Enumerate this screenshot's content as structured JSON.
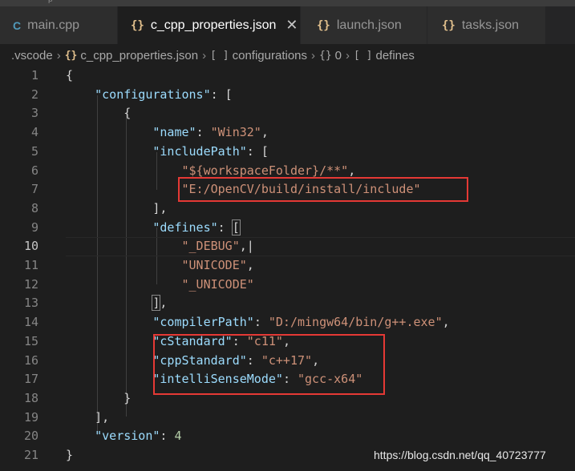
{
  "window": {
    "title_fragment": "p"
  },
  "tabs": [
    {
      "label": "main.cpp",
      "icon": "C"
    },
    {
      "label": "c_cpp_properties.json",
      "icon": "{}",
      "close": "✕"
    },
    {
      "label": "launch.json",
      "icon": "{}"
    },
    {
      "label": "tasks.json",
      "icon": "{}"
    }
  ],
  "breadcrumb": [
    {
      "label": ".vscode",
      "sym": ""
    },
    {
      "label": "c_cpp_properties.json",
      "sym": "{}"
    },
    {
      "label": "configurations",
      "sym": "[ ]"
    },
    {
      "label": "0",
      "sym": "{}"
    },
    {
      "label": "defines",
      "sym": "[ ]"
    }
  ],
  "editor": {
    "current_line": 10,
    "lines": [
      {
        "num": "1",
        "tokens": [
          {
            "t": "{",
            "c": "p"
          }
        ]
      },
      {
        "num": "2",
        "tokens": [
          {
            "t": "    ",
            "c": "p"
          },
          {
            "t": "\"configurations\"",
            "c": "k"
          },
          {
            "t": ": [",
            "c": "p"
          }
        ]
      },
      {
        "num": "3",
        "tokens": [
          {
            "t": "        {",
            "c": "p"
          }
        ]
      },
      {
        "num": "4",
        "tokens": [
          {
            "t": "            ",
            "c": "p"
          },
          {
            "t": "\"name\"",
            "c": "k"
          },
          {
            "t": ": ",
            "c": "p"
          },
          {
            "t": "\"Win32\"",
            "c": "s"
          },
          {
            "t": ",",
            "c": "p"
          }
        ]
      },
      {
        "num": "5",
        "tokens": [
          {
            "t": "            ",
            "c": "p"
          },
          {
            "t": "\"includePath\"",
            "c": "k"
          },
          {
            "t": ": [",
            "c": "p"
          }
        ]
      },
      {
        "num": "6",
        "tokens": [
          {
            "t": "                ",
            "c": "p"
          },
          {
            "t": "\"${workspaceFolder}/**\"",
            "c": "s"
          },
          {
            "t": ",",
            "c": "p"
          }
        ]
      },
      {
        "num": "7",
        "tokens": [
          {
            "t": "                ",
            "c": "p"
          },
          {
            "t": "\"E:/OpenCV/build/install/include\"",
            "c": "s"
          }
        ]
      },
      {
        "num": "8",
        "tokens": [
          {
            "t": "            ],",
            "c": "p"
          }
        ]
      },
      {
        "num": "9",
        "tokens": [
          {
            "t": "            ",
            "c": "p"
          },
          {
            "t": "\"defines\"",
            "c": "k"
          },
          {
            "t": ": ",
            "c": "p"
          },
          {
            "t": "[",
            "c": "p bm"
          }
        ]
      },
      {
        "num": "10",
        "tokens": [
          {
            "t": "                ",
            "c": "p"
          },
          {
            "t": "\"_DEBUG\"",
            "c": "s"
          },
          {
            "t": ",|",
            "c": "p"
          }
        ]
      },
      {
        "num": "11",
        "tokens": [
          {
            "t": "                ",
            "c": "p"
          },
          {
            "t": "\"UNICODE\"",
            "c": "s"
          },
          {
            "t": ",",
            "c": "p"
          }
        ]
      },
      {
        "num": "12",
        "tokens": [
          {
            "t": "                ",
            "c": "p"
          },
          {
            "t": "\"_UNICODE\"",
            "c": "s"
          }
        ]
      },
      {
        "num": "13",
        "tokens": [
          {
            "t": "            ",
            "c": "p"
          },
          {
            "t": "]",
            "c": "p bm"
          },
          {
            "t": ",",
            "c": "p"
          }
        ]
      },
      {
        "num": "14",
        "tokens": [
          {
            "t": "            ",
            "c": "p"
          },
          {
            "t": "\"compilerPath\"",
            "c": "k"
          },
          {
            "t": ": ",
            "c": "p"
          },
          {
            "t": "\"D:/mingw64/bin/g++.exe\"",
            "c": "s"
          },
          {
            "t": ",",
            "c": "p"
          }
        ]
      },
      {
        "num": "15",
        "tokens": [
          {
            "t": "            ",
            "c": "p"
          },
          {
            "t": "\"cStandard\"",
            "c": "k"
          },
          {
            "t": ": ",
            "c": "p"
          },
          {
            "t": "\"c11\"",
            "c": "s"
          },
          {
            "t": ",",
            "c": "p"
          }
        ]
      },
      {
        "num": "16",
        "tokens": [
          {
            "t": "            ",
            "c": "p"
          },
          {
            "t": "\"cppStandard\"",
            "c": "k"
          },
          {
            "t": ": ",
            "c": "p"
          },
          {
            "t": "\"c++17\"",
            "c": "s"
          },
          {
            "t": ",",
            "c": "p"
          }
        ]
      },
      {
        "num": "17",
        "tokens": [
          {
            "t": "            ",
            "c": "p"
          },
          {
            "t": "\"intelliSenseMode\"",
            "c": "k"
          },
          {
            "t": ": ",
            "c": "p"
          },
          {
            "t": "\"gcc-x64\"",
            "c": "s"
          }
        ]
      },
      {
        "num": "18",
        "tokens": [
          {
            "t": "        }",
            "c": "p"
          }
        ]
      },
      {
        "num": "19",
        "tokens": [
          {
            "t": "    ],",
            "c": "p"
          }
        ]
      },
      {
        "num": "20",
        "tokens": [
          {
            "t": "    ",
            "c": "p"
          },
          {
            "t": "\"version\"",
            "c": "k"
          },
          {
            "t": ": ",
            "c": "p"
          },
          {
            "t": "4",
            "c": "n"
          }
        ]
      },
      {
        "num": "21",
        "tokens": [
          {
            "t": "}",
            "c": "p"
          }
        ]
      }
    ]
  },
  "watermark": "https://blog.csdn.net/qq_40723777",
  "colors": {
    "key": "#9cdcfe",
    "string": "#ce9178",
    "number": "#b5cea8",
    "annotation_box": "#e53935",
    "cpp_icon": "#519aba",
    "json_icon": "#e2c08d"
  }
}
